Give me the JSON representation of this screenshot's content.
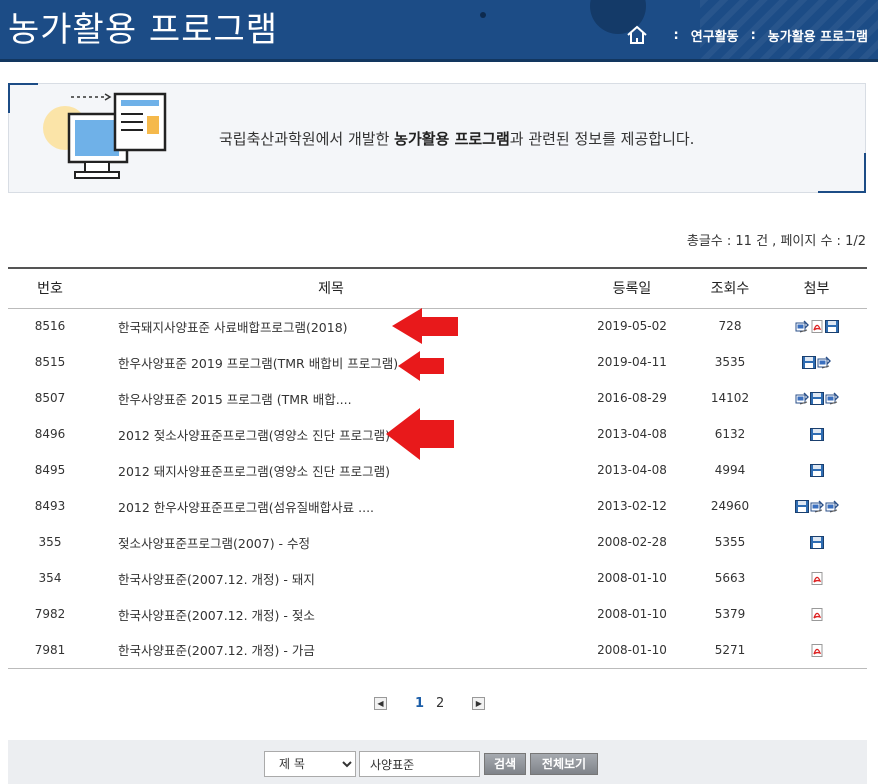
{
  "header": {
    "title": "농가활용 프로그램",
    "breadcrumb": {
      "sep1": ":",
      "level1": "연구활동",
      "sep2": ":",
      "level2": "농가활용 프로그램"
    }
  },
  "intro": {
    "text_pre": "국립축산과학원에서 개발한 ",
    "text_bold": "농가활용 프로그램",
    "text_post": "과 관련된 정보를 제공합니다."
  },
  "count": {
    "text": "총글수 : 11 건 , 페이지 수 : 1/2"
  },
  "table": {
    "headers": {
      "no": "번호",
      "title": "제목",
      "date": "등록일",
      "views": "조회수",
      "attach": "첨부"
    },
    "rows": [
      {
        "no": "8516",
        "title": "한국돼지사양표준 사료배합프로그램(2018)",
        "date": "2019-05-02",
        "views": "728",
        "attachments": [
          "program-icon",
          "pdf-icon",
          "disk-icon"
        ]
      },
      {
        "no": "8515",
        "title": "한우사양표준 2019 프로그램(TMR 배합비 프로그램)",
        "date": "2019-04-11",
        "views": "3535",
        "attachments": [
          "disk-icon",
          "program-icon"
        ]
      },
      {
        "no": "8507",
        "title": "한우사양표준 2015 프로그램 (TMR 배합....",
        "date": "2016-08-29",
        "views": "14102",
        "attachments": [
          "program-icon",
          "disk-icon",
          "program-icon"
        ]
      },
      {
        "no": "8496",
        "title": "2012 젖소사양표준프로그램(영양소 진단 프로그램)",
        "date": "2013-04-08",
        "views": "6132",
        "attachments": [
          "disk-icon"
        ]
      },
      {
        "no": "8495",
        "title": "2012 돼지사양표준프로그램(영양소 진단 프로그램)",
        "date": "2013-04-08",
        "views": "4994",
        "attachments": [
          "disk-icon"
        ]
      },
      {
        "no": "8493",
        "title": "2012 한우사양표준프로그램(섬유질배합사료 ....",
        "date": "2013-02-12",
        "views": "24960",
        "attachments": [
          "disk-icon",
          "program-icon",
          "program-icon"
        ]
      },
      {
        "no": "355",
        "title": "젖소사양표준프로그램(2007) - 수정",
        "date": "2008-02-28",
        "views": "5355",
        "attachments": [
          "disk-icon"
        ]
      },
      {
        "no": "354",
        "title": "한국사양표준(2007.12. 개정) - 돼지",
        "date": "2008-01-10",
        "views": "5663",
        "attachments": [
          "pdf-icon"
        ]
      },
      {
        "no": "7982",
        "title": "한국사양표준(2007.12. 개정) - 젖소",
        "date": "2008-01-10",
        "views": "5379",
        "attachments": [
          "pdf-icon"
        ]
      },
      {
        "no": "7981",
        "title": "한국사양표준(2007.12. 개정) - 가금",
        "date": "2008-01-10",
        "views": "5271",
        "attachments": [
          "pdf-icon"
        ]
      }
    ]
  },
  "pagination": {
    "prev": "◀",
    "pages": [
      "1",
      "2"
    ],
    "current": "1",
    "next": "▶"
  },
  "search": {
    "field_options": [
      "제 목"
    ],
    "selected_field": "제 목",
    "query_value": "사양표준",
    "search_button": "검색",
    "view_all_button": "전체보기"
  },
  "colors": {
    "header_bg": "#1c4c86",
    "arrow": "#e8191b",
    "active_page": "#1c5ea8"
  }
}
